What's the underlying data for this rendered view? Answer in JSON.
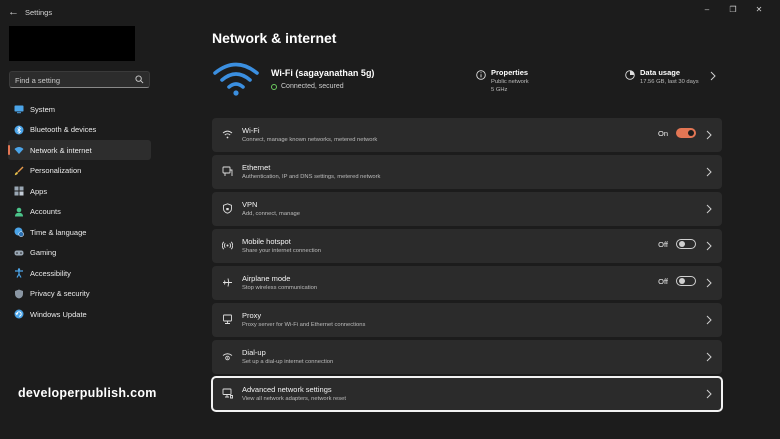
{
  "window": {
    "title": "Settings",
    "minimize_icon": "minimize-icon",
    "maximize_icon": "maximize-icon",
    "close_icon": "close-icon"
  },
  "search": {
    "placeholder": "Find a setting"
  },
  "sidebar": {
    "items": [
      {
        "label": "System",
        "icon": "monitor-icon",
        "color": "#4ba4e8"
      },
      {
        "label": "Bluetooth & devices",
        "icon": "bluetooth-icon",
        "color": "#4ba4e8"
      },
      {
        "label": "Network & internet",
        "icon": "wifi-icon",
        "color": "#4ba4e8",
        "active": true
      },
      {
        "label": "Personalization",
        "icon": "brush-icon",
        "color": "#e89a4b"
      },
      {
        "label": "Apps",
        "icon": "apps-icon",
        "color": "#9aa7b4"
      },
      {
        "label": "Accounts",
        "icon": "person-icon",
        "color": "#4bc48a"
      },
      {
        "label": "Time & language",
        "icon": "globe-clock-icon",
        "color": "#4ba4e8"
      },
      {
        "label": "Gaming",
        "icon": "gamepad-icon",
        "color": "#9aa7b4"
      },
      {
        "label": "Accessibility",
        "icon": "accessibility-icon",
        "color": "#4ba4e8"
      },
      {
        "label": "Privacy & security",
        "icon": "shield-icon",
        "color": "#8a96a3"
      },
      {
        "label": "Windows Update",
        "icon": "update-icon",
        "color": "#4ba4e8"
      }
    ]
  },
  "watermark": "developerpublish.com",
  "main": {
    "title": "Network & internet",
    "hero": {
      "network_name": "Wi-Fi (sagayanathan 5g)",
      "status": "Connected, secured",
      "properties": {
        "title": "Properties",
        "line1": "Public network",
        "line2": "5 GHz"
      },
      "data_usage": {
        "title": "Data usage",
        "line1": "17.56 GB, last 30 days"
      }
    },
    "rows": [
      {
        "title": "Wi-Fi",
        "desc": "Connect, manage known networks, metered network",
        "icon": "wifi-icon",
        "toggle": "On"
      },
      {
        "title": "Ethernet",
        "desc": "Authentication, IP and DNS settings, metered network",
        "icon": "ethernet-icon"
      },
      {
        "title": "VPN",
        "desc": "Add, connect, manage",
        "icon": "vpn-shield-icon"
      },
      {
        "title": "Mobile hotspot",
        "desc": "Share your internet connection",
        "icon": "hotspot-icon",
        "toggle": "Off"
      },
      {
        "title": "Airplane mode",
        "desc": "Stop wireless communication",
        "icon": "airplane-icon",
        "toggle": "Off"
      },
      {
        "title": "Proxy",
        "desc": "Proxy server for Wi-Fi and Ethernet connections",
        "icon": "proxy-icon"
      },
      {
        "title": "Dial-up",
        "desc": "Set up a dial-up internet connection",
        "icon": "dialup-icon"
      },
      {
        "title": "Advanced network settings",
        "desc": "View all network adapters, network reset",
        "icon": "advanced-network-icon"
      }
    ]
  },
  "colors": {
    "accent": "#e37654",
    "background": "#1c1c1c",
    "card": "#2b2b2b",
    "wifi_blue": "#3b8fe0"
  }
}
